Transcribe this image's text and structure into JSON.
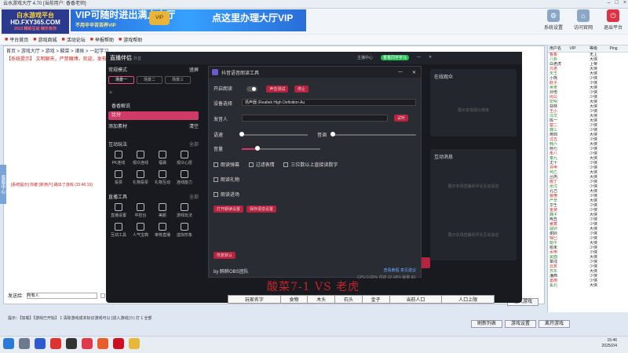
{
  "window": {
    "title": "云水游戏大厅 4.70 [当前用户: 香香老师]"
  },
  "banner": {
    "logo_line1": "白水游戏平台",
    "logo_line2": "HD.FXY365.COM",
    "logo_line3": "2013 精彩互动 娱乐有你",
    "vip_main": "VIP可随时进出满人大厅",
    "vip_sub": "不用辛辛苦苦养VIP",
    "vip_badge": "VIP",
    "vip_right": "点这里办理大厅VIP"
  },
  "top_icons": [
    {
      "label": "系统设置",
      "icon": "gear-icon"
    },
    {
      "label": "访问官网",
      "icon": "home-icon"
    },
    {
      "label": "退出平台",
      "icon": "exit-icon"
    }
  ],
  "toolbar": [
    {
      "label": "平台首页"
    },
    {
      "label": "游戏商城"
    },
    {
      "label": "活动论坛"
    },
    {
      "label": "举报帮助"
    },
    {
      "label": "游戏帮助"
    }
  ],
  "nav": {
    "line": "首页 > 游戏大厅 > 游戏 > 酸菜 > 诸侯 > 一起学习"
  },
  "notice": "【系统提示】 文明聊天，严禁赌博，欢迎，发布前请。",
  "side_tab": "客服中心",
  "syslog": "[系统提示] 你被 [新用户] 踢出了游戏 (15:46:16)",
  "chat": {
    "label": "发送给:",
    "target": "所有人",
    "checkbox": "私聊",
    "send": "发送"
  },
  "bottom": "提示：【加载】【游戏已开始】 1 清除游戏成本标识游戏可以 [进入游戏] 0 | 打 1 全部",
  "right_buttons": [
    "进入游戏",
    "离开大厅"
  ],
  "right_buttons2": [
    "刷新列表",
    "游戏设置",
    "离开游戏"
  ],
  "userlist": {
    "headers": [
      "用户名",
      "VIP",
      "等级",
      "Ping"
    ],
    "rows": [
      [
        "香香",
        "",
        "无上",
        ""
      ],
      [
        "八卦",
        "",
        "大侠",
        ""
      ],
      [
        "白老虎",
        "",
        "上帝",
        ""
      ],
      [
        "元老",
        "",
        "大侠",
        ""
      ],
      [
        "天王",
        "",
        "大侠",
        ""
      ],
      [
        "小熊",
        "",
        "少侠",
        ""
      ],
      [
        "赵子",
        "",
        "少侠",
        ""
      ],
      [
        "吴老",
        "",
        "大侠",
        ""
      ],
      [
        "孙悟",
        "",
        "少侠",
        ""
      ],
      [
        "周公",
        "",
        "少侠",
        ""
      ],
      [
        "宏明",
        "",
        "大侠",
        ""
      ],
      [
        "郑林",
        "",
        "大侠",
        ""
      ],
      [
        "王小",
        "",
        "少侠",
        ""
      ],
      [
        "冯文",
        "",
        "大侠",
        ""
      ],
      [
        "陈一",
        "",
        "大侠",
        ""
      ],
      [
        "楚二",
        "",
        "少侠",
        ""
      ],
      [
        "魏三",
        "",
        "少侠",
        ""
      ],
      [
        "蒋四",
        "",
        "大侠",
        ""
      ],
      [
        "沈五",
        "",
        "少侠",
        ""
      ],
      [
        "韩六",
        "",
        "大侠",
        ""
      ],
      [
        "杨七",
        "",
        "少侠",
        ""
      ],
      [
        "朱八",
        "",
        "少侠",
        ""
      ],
      [
        "秦九",
        "",
        "大侠",
        ""
      ],
      [
        "尤十",
        "",
        "少侠",
        ""
      ],
      [
        "许甲",
        "",
        "少侠",
        ""
      ],
      [
        "何乙",
        "",
        "大侠",
        ""
      ],
      [
        "吕丙",
        "",
        "大侠",
        ""
      ],
      [
        "施丁",
        "",
        "少侠",
        ""
      ],
      [
        "张戊",
        "",
        "少侠",
        ""
      ],
      [
        "孔己",
        "",
        "大侠",
        ""
      ],
      [
        "曹庚",
        "",
        "少侠",
        ""
      ],
      [
        "严辛",
        "",
        "大侠",
        ""
      ],
      [
        "华壬",
        "",
        "少侠",
        ""
      ],
      [
        "金癸",
        "",
        "少侠",
        ""
      ],
      [
        "魏子",
        "",
        "大侠",
        ""
      ],
      [
        "陶丑",
        "",
        "少侠",
        ""
      ],
      [
        "姜寅",
        "",
        "少侠",
        ""
      ],
      [
        "戚卯",
        "",
        "大侠",
        ""
      ],
      [
        "谢辰",
        "",
        "少侠",
        ""
      ],
      [
        "邹巳",
        "",
        "少侠",
        ""
      ],
      [
        "喻午",
        "",
        "大侠",
        ""
      ],
      [
        "柏未",
        "",
        "少侠",
        ""
      ],
      [
        "水申",
        "",
        "少侠",
        ""
      ],
      [
        "窦酉",
        "",
        "大侠",
        ""
      ],
      [
        "章戌",
        "",
        "少侠",
        ""
      ],
      [
        "云亥",
        "",
        "少侠",
        ""
      ],
      [
        "苏东",
        "",
        "大侠",
        ""
      ],
      [
        "潘西",
        "",
        "少侠",
        ""
      ],
      [
        "葛南",
        "",
        "少侠",
        ""
      ],
      [
        "奚北",
        "",
        "大侠",
        ""
      ]
    ]
  },
  "obs": {
    "app_title": "直播伴侣",
    "app_sub": "抖音",
    "header_right": [
      "主播中心",
      "香香同学罗马"
    ],
    "mode_label": "常规模式",
    "landscape": "竖屏",
    "scenes": [
      "场景一",
      "场景二",
      "场景三"
    ],
    "sources": [
      "香香解说",
      "比分"
    ],
    "add_source": "添加素材",
    "clear": "清空",
    "interact_title": "互动玩法",
    "interact_all": "全部",
    "interact_items": [
      "PK连线",
      "观众连线",
      "福袋",
      "观众心愿",
      "投票",
      "礼物投票",
      "礼物互动",
      "连线能力"
    ],
    "tools_title": "直播工具",
    "tools_all": "全部",
    "tools_items": [
      "直播设置",
      "中控台",
      "美颜",
      "游戏玩法",
      "互动工具",
      "人气宝典",
      "审核直播",
      "虚拟形象"
    ],
    "right_panel1_title": "在线观众",
    "right_panel1_msg": "展示本场观众榜单",
    "right_panel2_title": "互动消息",
    "right_panel2_msg": "展示本场直播的评论互动消息",
    "start_btn": "开始直播"
  },
  "dialog": {
    "title": "抖音语音朗读工具",
    "start_label": "开启朗读",
    "btn_test": "声音测试",
    "btn_stop": "停止",
    "device_label": "设备选择",
    "device_value": "扬声器 (Realtek High Definition Au",
    "speaker_label": "发音人",
    "speaker_btn": "试听",
    "speed_label": "语速",
    "pitch_label": "音调",
    "volume_label": "音量",
    "check_welcome": "朗读弹幕",
    "check_filter": "过滤表情",
    "check_digits": "三位数以上直接读数字",
    "check_gift": "朗读礼物",
    "check_enter": "朗读进场",
    "btn_open": "打开朗读设置",
    "btn_save": "保存语音设置",
    "btn_reset": "恢复默认",
    "footer": "by 醉醉OBS团队",
    "footer_links": "查看教程 意见建议",
    "speed": 0.0,
    "pitch": 0.0,
    "volume": 0.2
  },
  "overlay": {
    "score": "酸菜7-1 VS 老虎",
    "cpu": "CPU 0.00%  内存 22.00%  帧率 60"
  },
  "game_table": {
    "headers": [
      "玩家名字",
      "食物",
      "木头",
      "石头",
      "金子",
      "当前人口",
      "人口上限"
    ]
  },
  "taskbar": {
    "time": "15:46",
    "date": "2025/2/4"
  },
  "colors": {
    "accent": "#d03a66",
    "vip_blue": "#2a6dd8",
    "score_red": "#c0262c"
  }
}
